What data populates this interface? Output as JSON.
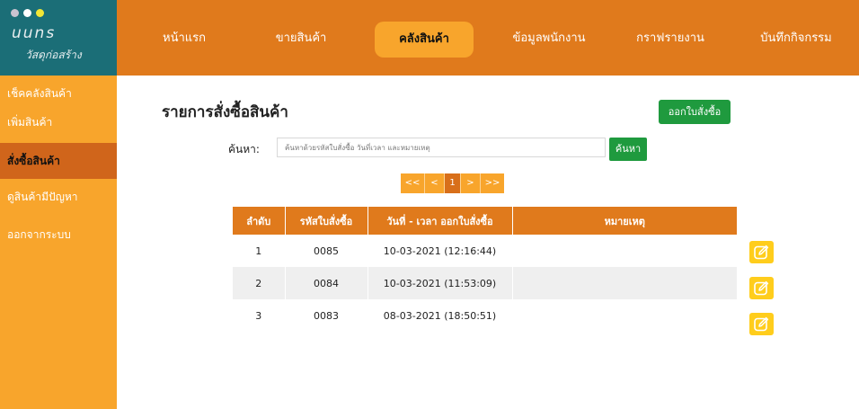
{
  "app": {
    "title": "uuns",
    "subtitle": "วัสดุก่อสร้าง",
    "window_dot_colors": [
      "#c9c3d0",
      "#ffffff",
      "#f2e635"
    ]
  },
  "nav": {
    "items": [
      {
        "label": "หน้าแรก"
      },
      {
        "label": "ขายสินค้า"
      },
      {
        "label": "คลังสินค้า",
        "active": true
      },
      {
        "label": "ข้อมูลพนักงาน"
      },
      {
        "label": "กราฟรายงาน"
      },
      {
        "label": "บันทึกกิจกรรม"
      }
    ]
  },
  "sidebar": {
    "items": [
      {
        "label": "เช็คคลังสินค้า"
      },
      {
        "label": "เพิ่มสินค้า"
      },
      {
        "label": "สั่งซื้อสินค้า",
        "active": true
      },
      {
        "label": "ดูสินค้ามีปัญหา"
      },
      {
        "label": "ออกจากระบบ"
      }
    ]
  },
  "main": {
    "title": "รายการสั่งซื้อสินค้า",
    "create_button": "ออกใบสั่งซื้อ",
    "search": {
      "label": "ค้นหา:",
      "placeholder": "ค้นหาด้วยรหัสใบสั่งซื้อ วันที่เวลา และหมายเหตุ",
      "value": "",
      "button": "ค้นหา"
    },
    "pagination": {
      "first": "<<",
      "prev": "<",
      "current": "1",
      "next": ">",
      "last": ">>"
    }
  },
  "table": {
    "headers": [
      "ลำดับ",
      "รหัสใบสั่งซื้อ",
      "วันที่ - เวลา ออกใบสั่งซื้อ",
      "หมายเหตุ"
    ],
    "rows": [
      {
        "no": "1",
        "code": "0085",
        "datetime": "10-03-2021 (12:16:44)",
        "note": ""
      },
      {
        "no": "2",
        "code": "0084",
        "datetime": "10-03-2021 (11:53:09)",
        "note": ""
      },
      {
        "no": "3",
        "code": "0083",
        "datetime": "08-03-2021 (18:50:51)",
        "note": ""
      }
    ],
    "row_action_icon": "edit-icon"
  },
  "colors": {
    "topbar": "#e07a1c",
    "logo_bg": "#1b6e77",
    "sidebar": "#f8a52c",
    "sidebar_active": "#d0651b",
    "green_button": "#1f9a3e",
    "edit_button": "#ffcd1c"
  }
}
